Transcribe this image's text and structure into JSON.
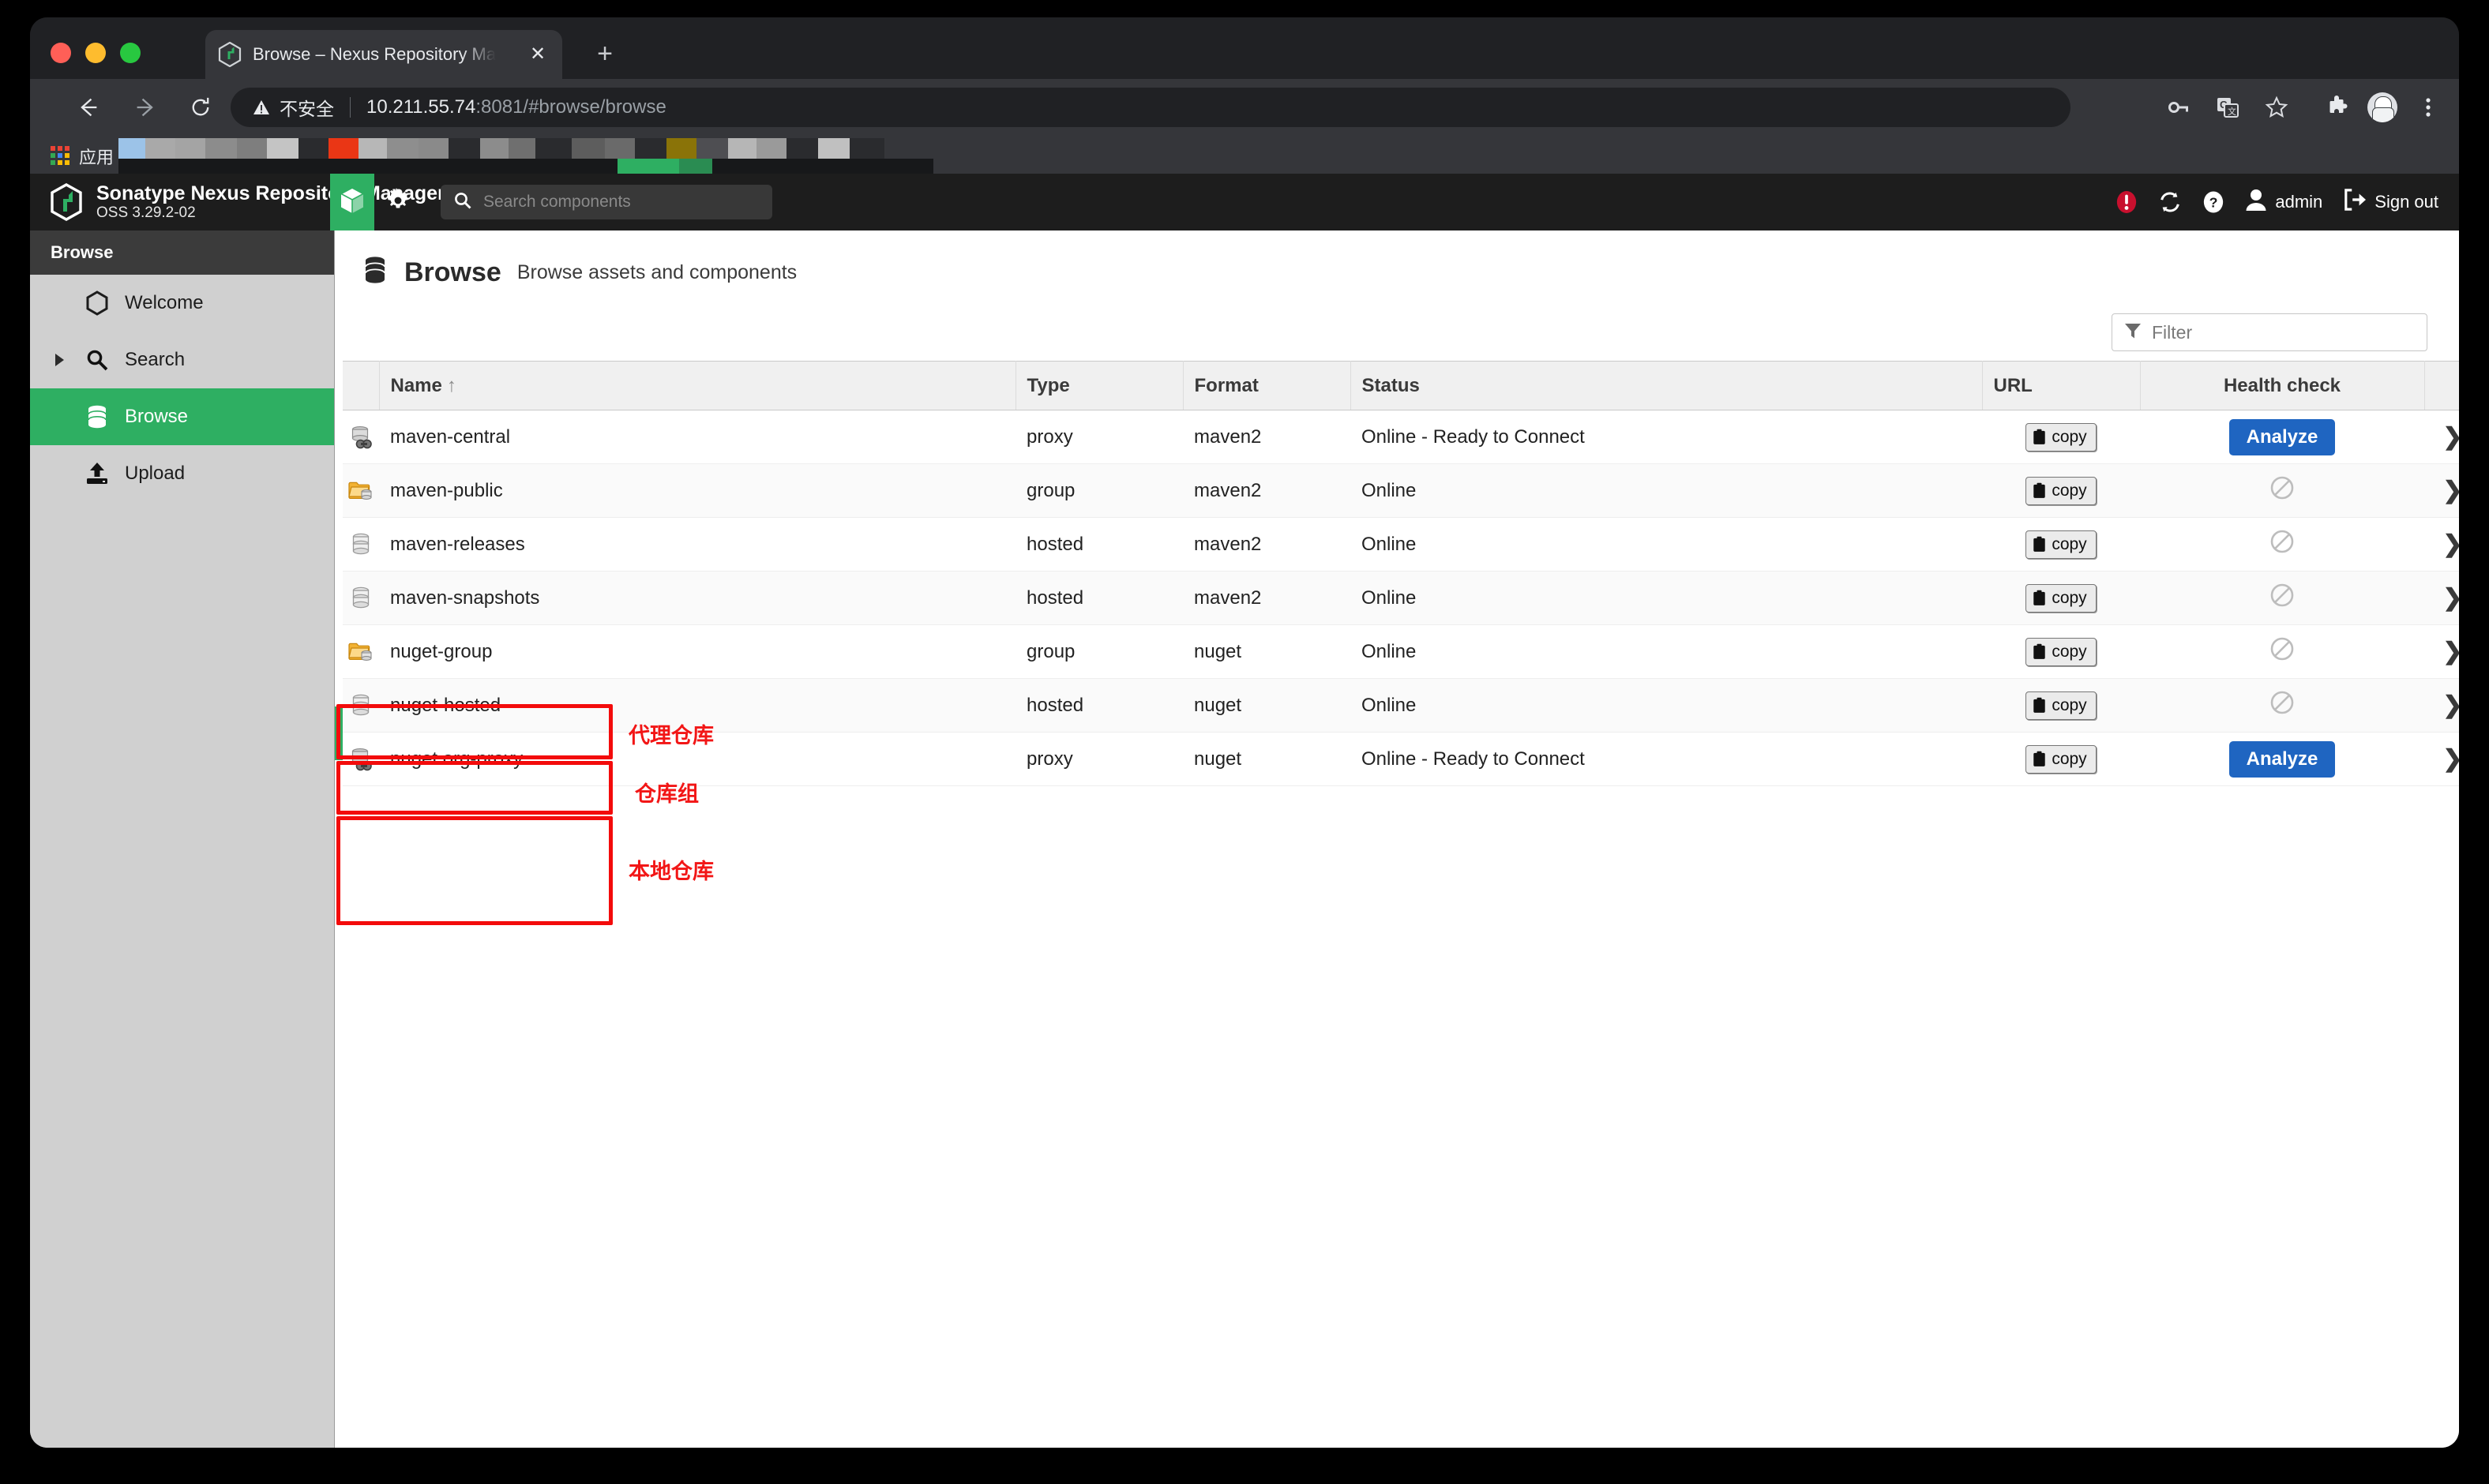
{
  "browser": {
    "tab": {
      "title": "Browse – Nexus Repository Ma",
      "close_label": "✕",
      "favicon": "nexus-favicon"
    },
    "newtab_label": "+",
    "omnibox": {
      "insecure_label": "不安全",
      "url_host": "10.211.55.74",
      "url_rest": ":8081/#browse/browse"
    },
    "bookmarks": {
      "apps_label": "应用"
    },
    "toolbar_icons": [
      "key-icon",
      "translate-icon",
      "star-icon",
      "extensions-icon",
      "profile-avatar",
      "chrome-menu-icon"
    ]
  },
  "nexus": {
    "brand": {
      "title": "Sonatype Nexus Repository Manager",
      "version": "OSS 3.29.2-02"
    },
    "tabs": {
      "browse": "browse-cube-icon",
      "admin": "gear-icon"
    },
    "search": {
      "placeholder": "Search components",
      "value": ""
    },
    "user": {
      "name": "admin",
      "signout_label": "Sign out"
    },
    "header_icons": [
      "alert-icon",
      "refresh-icon",
      "help-icon",
      "user-icon",
      "signout-icon"
    ]
  },
  "sidebar": {
    "header": "Browse",
    "items": [
      {
        "label": "Welcome",
        "icon": "hexagon-icon",
        "active": false,
        "caret": false
      },
      {
        "label": "Search",
        "icon": "search-icon",
        "active": false,
        "caret": true
      },
      {
        "label": "Browse",
        "icon": "database-icon",
        "active": true,
        "caret": false
      },
      {
        "label": "Upload",
        "icon": "upload-icon",
        "active": false,
        "caret": false
      }
    ]
  },
  "main": {
    "title": "Browse",
    "subtitle": "Browse assets and components",
    "filter": {
      "placeholder": "Filter",
      "value": ""
    },
    "table": {
      "columns": [
        "",
        "Name",
        "Type",
        "Format",
        "Status",
        "URL",
        "Health check",
        ""
      ],
      "sort_column": "Name",
      "sort_indicator": "↑",
      "copy_label": "copy",
      "analyze_label": "Analyze",
      "rows": [
        {
          "icon": "proxy-repo-icon",
          "name": "maven-central",
          "type": "proxy",
          "format": "maven2",
          "status": "Online - Ready to Connect",
          "url": "copy",
          "health": "Analyze"
        },
        {
          "icon": "group-repo-icon",
          "name": "maven-public",
          "type": "group",
          "format": "maven2",
          "status": "Online",
          "url": "copy",
          "health": "none"
        },
        {
          "icon": "hosted-repo-icon",
          "name": "maven-releases",
          "type": "hosted",
          "format": "maven2",
          "status": "Online",
          "url": "copy",
          "health": "none"
        },
        {
          "icon": "hosted-repo-icon",
          "name": "maven-snapshots",
          "type": "hosted",
          "format": "maven2",
          "status": "Online",
          "url": "copy",
          "health": "none"
        },
        {
          "icon": "group-repo-icon",
          "name": "nuget-group",
          "type": "group",
          "format": "nuget",
          "status": "Online",
          "url": "copy",
          "health": "none"
        },
        {
          "icon": "hosted-repo-icon",
          "name": "nuget-hosted",
          "type": "hosted",
          "format": "nuget",
          "status": "Online",
          "url": "copy",
          "health": "none"
        },
        {
          "icon": "proxy-repo-icon",
          "name": "nuget.org-proxy",
          "type": "proxy",
          "format": "nuget",
          "status": "Online - Ready to Connect",
          "url": "copy",
          "health": "Analyze"
        }
      ]
    }
  },
  "annotations": {
    "color": "#f21616",
    "labels": [
      {
        "text": "代理仓库",
        "for": "maven-central"
      },
      {
        "text": "仓库组",
        "for": "maven-public"
      },
      {
        "text": "本地仓库",
        "for": "maven-releases+maven-snapshots"
      }
    ]
  }
}
